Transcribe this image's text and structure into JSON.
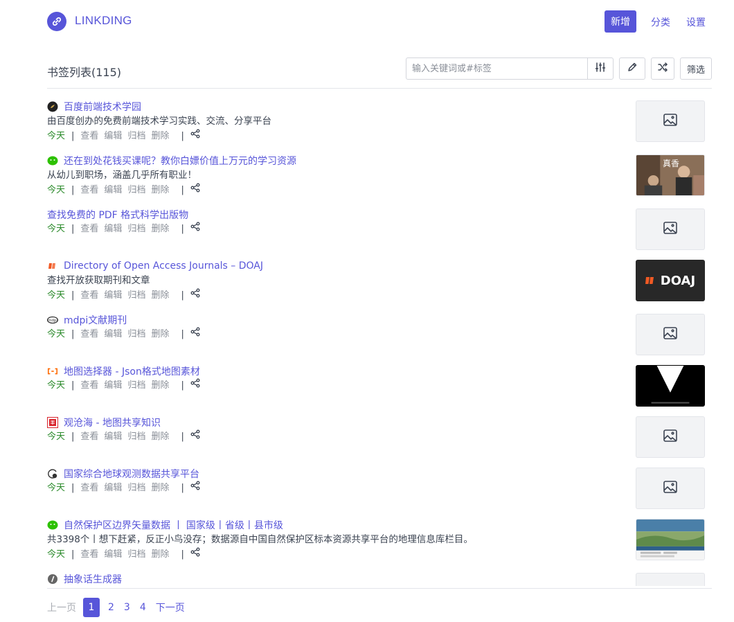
{
  "header": {
    "brand": "LINKDING",
    "new_label": "新增",
    "nav": [
      "分类",
      "设置"
    ]
  },
  "toolbar": {
    "title": "书签列表(115)",
    "search_placeholder": "输入关键词或#标签",
    "filter_label": "筛选"
  },
  "actions": {
    "date": "今天",
    "view": "查看",
    "edit": "编辑",
    "archive": "归档",
    "delete": "删除"
  },
  "bookmarks": [
    {
      "title": "百度前端技术学园",
      "desc": "由百度创办的免费前端技术学习实践、交流、分享平台",
      "favicon": "dark-circle-icon",
      "thumb": "placeholder"
    },
    {
      "title": "还在到处花钱买课呢？教你白嫖价值上万元的学习资源",
      "desc": "从幼儿到职场，涵盖几乎所有职业！",
      "favicon": "wechat-icon",
      "thumb": "photo",
      "thumb_text": "真香"
    },
    {
      "title": "查找免费的 PDF 格式科学出版物",
      "desc": "",
      "favicon": "",
      "thumb": "placeholder"
    },
    {
      "title": "Directory of Open Access Journals – DOAJ",
      "desc": "查找开放获取期刊和文章",
      "favicon": "doaj-icon",
      "thumb": "doaj",
      "thumb_text": "DOAJ"
    },
    {
      "title": "mdpi文献期刊",
      "desc": "",
      "favicon": "mdpi-icon",
      "thumb": "placeholder"
    },
    {
      "title": "地图选择器 - Json格式地图素材",
      "desc": "",
      "favicon": "datav-icon",
      "thumb": "black"
    },
    {
      "title": "观沧海 - 地图共享知识",
      "desc": "",
      "favicon": "red-seal-icon",
      "thumb": "placeholder"
    },
    {
      "title": "国家综合地球观测数据共享平台",
      "desc": "",
      "favicon": "gear-globe-icon",
      "thumb": "placeholder"
    },
    {
      "title": "自然保护区边界矢量数据 丨 国家级丨省级丨县市级",
      "desc": "共3398个丨想下赶紧，反正小鸟没存；数据源自中国自然保护区标本资源共享平台的地理信息库栏目。",
      "favicon": "wechat-icon",
      "thumb": "web"
    },
    {
      "title": "抽象话生成器",
      "desc": "",
      "favicon": "gray-circle-icon",
      "thumb": "placeholder"
    }
  ],
  "pagination": {
    "prev": "上一页",
    "pages": [
      "1",
      "2",
      "3",
      "4"
    ],
    "current": "1",
    "next": "下一页"
  },
  "colors": {
    "accent": "#5755d9",
    "date": "#2a8a2a",
    "muted": "#8a8f98"
  }
}
